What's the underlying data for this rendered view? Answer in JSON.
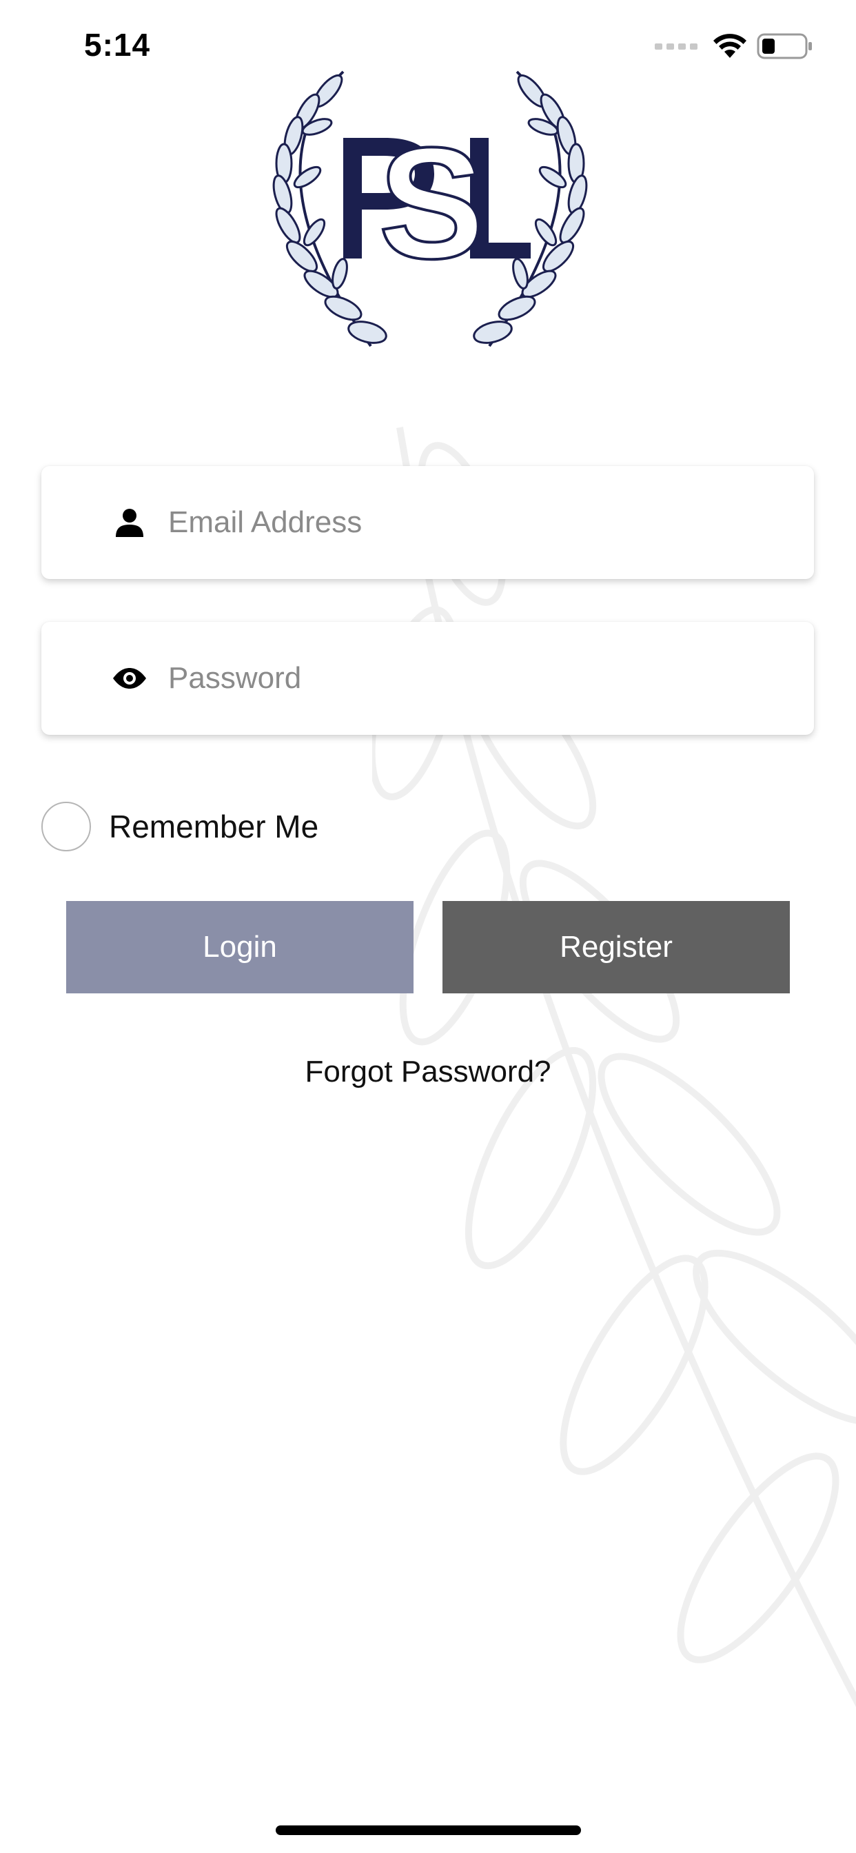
{
  "status_bar": {
    "time": "5:14",
    "icons": [
      "cellular-signal-icon",
      "wifi-icon",
      "battery-icon"
    ]
  },
  "logo": {
    "text": "PSL",
    "icon": "laurel-wreath-icon",
    "color": "#1b1f4e"
  },
  "login_form": {
    "email": {
      "icon": "user-icon",
      "placeholder": "Email Address",
      "value": ""
    },
    "password": {
      "icon": "eye-icon",
      "placeholder": "Password",
      "value": ""
    },
    "remember_me": {
      "label": "Remember Me",
      "checked": false
    },
    "login_button": {
      "label": "Login",
      "color": "#8a8fa8"
    },
    "register_button": {
      "label": "Register",
      "color": "#616161"
    },
    "forgot_password_link": "Forgot Password?"
  }
}
